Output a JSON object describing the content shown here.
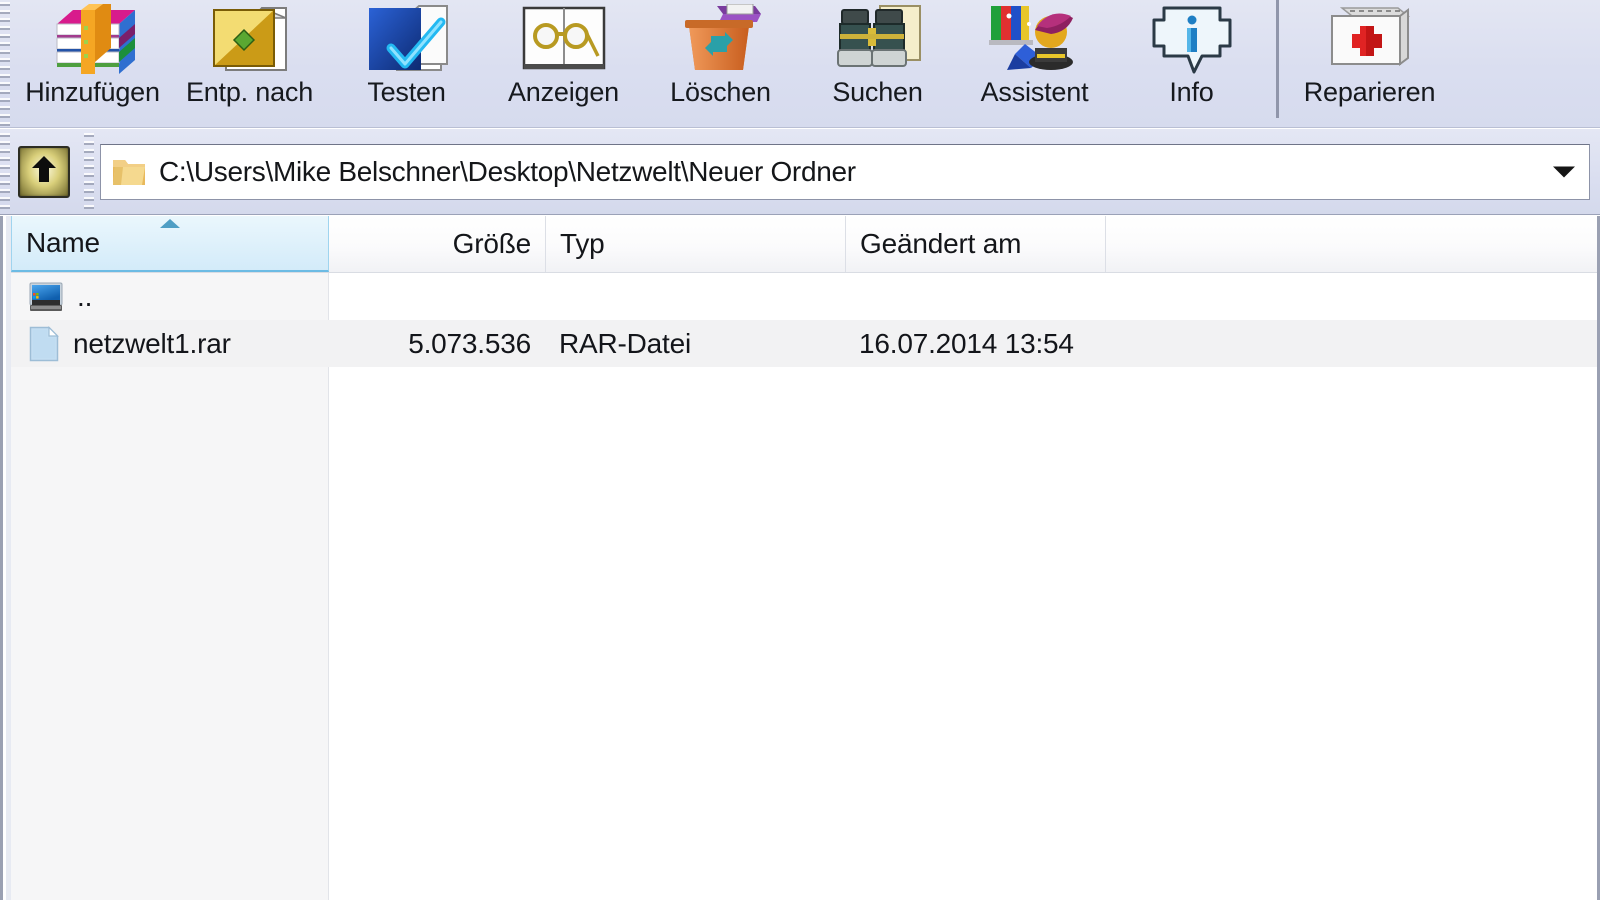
{
  "toolbar": {
    "buttons": [
      {
        "label": "Hinzufügen",
        "icon": "archive-add-icon"
      },
      {
        "label": "Entp. nach",
        "icon": "extract-to-icon"
      },
      {
        "label": "Testen",
        "icon": "test-archive-icon"
      },
      {
        "label": "Anzeigen",
        "icon": "view-file-icon"
      },
      {
        "label": "Löschen",
        "icon": "delete-trash-icon"
      },
      {
        "label": "Suchen",
        "icon": "find-binoculars-icon"
      },
      {
        "label": "Assistent",
        "icon": "wizard-icon"
      },
      {
        "label": "Info",
        "icon": "info-balloon-icon"
      }
    ],
    "buttons_after_separator": [
      {
        "label": "Reparieren",
        "icon": "repair-firstaid-icon"
      }
    ]
  },
  "address_bar": {
    "up_button_icon": "up-folder-arrow-icon",
    "folder_icon": "folder-icon",
    "path": "C:\\Users\\Mike Belschner\\Desktop\\Netzwelt\\Neuer Ordner",
    "dropdown_icon": "chevron-down-icon"
  },
  "file_list": {
    "columns": [
      {
        "key": "name",
        "label": "Name",
        "align": "left",
        "sorted": true,
        "sort_direction": "asc"
      },
      {
        "key": "size",
        "label": "Größe",
        "align": "right",
        "sorted": false
      },
      {
        "key": "type",
        "label": "Typ",
        "align": "left",
        "sorted": false
      },
      {
        "key": "modified",
        "label": "Geändert am",
        "align": "left",
        "sorted": false
      }
    ],
    "rows": [
      {
        "icon": "desktop-parent-folder-icon",
        "name": "..",
        "size": "",
        "type": "",
        "modified": ""
      },
      {
        "icon": "file-document-icon",
        "name": "netzwelt1.rar",
        "size": "5.073.536",
        "type": "RAR-Datei",
        "modified": "16.07.2014 13:54"
      }
    ]
  },
  "colors": {
    "toolbar_bg": "#dadef0",
    "sorted_header_bg": "#dff1fb",
    "sort_arrow": "#4f9ec4",
    "row_shaded": "#f2f2f3",
    "name_column_bg": "#f6f6f7",
    "text": "#13151a",
    "border": "#9aa0b2"
  }
}
